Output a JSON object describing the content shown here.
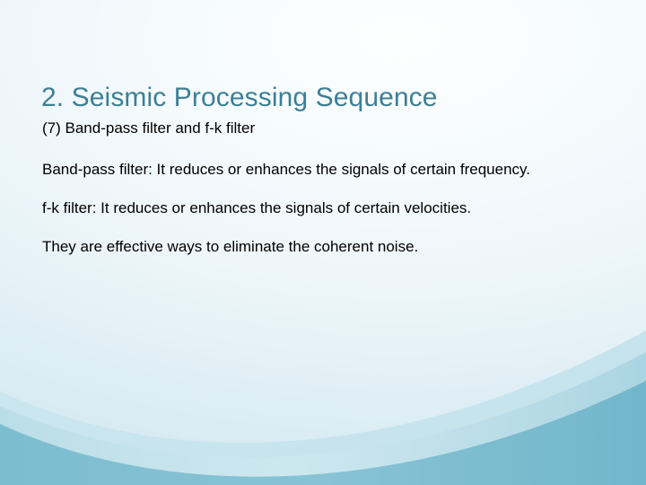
{
  "slide": {
    "title": "2. Seismic Processing Sequence",
    "paragraphs": [
      {
        "text": "(7) Band-pass filter and f-k filter",
        "align": "left"
      },
      {
        "text": "Band-pass filter: It reduces or enhances the signals of certain frequency.",
        "align": "justify"
      },
      {
        "text": "f-k filter: It reduces or enhances the signals of certain velocities.",
        "align": "justify"
      },
      {
        "text": "They are effective ways to eliminate the coherent noise.",
        "align": "left"
      }
    ]
  },
  "theme": {
    "title_color": "#3D7F97",
    "body_color": "#000000",
    "background_top": "#F7FBFD",
    "background_top_left": "#EFF6FB",
    "swoosh_dark": "#7CBDD0",
    "swoosh_light": "#AFD8E3"
  }
}
